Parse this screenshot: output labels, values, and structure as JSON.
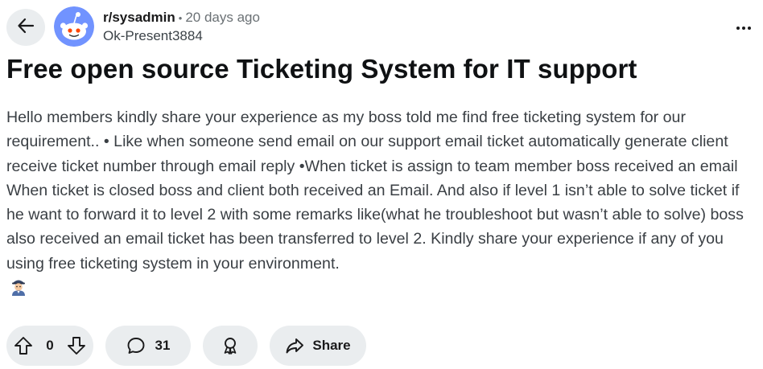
{
  "header": {
    "subreddit": "r/sysadmin",
    "separator": "•",
    "time_ago": "20 days ago",
    "username": "Ok-Present3884",
    "icons": {
      "back": "arrow-left-icon",
      "more": "more-horizontal-icon",
      "avatar": "reddit-snoo-avatar"
    }
  },
  "post": {
    "title": "Free open source Ticketing System for IT support",
    "body": "Hello members kindly share your experience as my boss told me find free ticketing system for our requirement.. • Like when someone send email on our support email ticket automatically generate client receive ticket number through email reply •When ticket is assign to team member boss received an email When ticket is closed boss and client both received an Email. And also if level 1 isn’t able to solve ticket if he want to forward it to level 2 with some remarks like(what he troubleshoot but wasn’t able to solve) boss also received an email ticket has been transferred to level 2. Kindly share your experience if any of you using free ticketing system in your environment.",
    "emoji_icon": "detective-emoji-icon"
  },
  "actions": {
    "vote_count": "0",
    "comment_count": "31",
    "share_label": "Share",
    "icons": {
      "upvote": "upvote-arrow-icon",
      "downvote": "downvote-arrow-icon",
      "comment": "comment-bubble-icon",
      "award": "award-icon",
      "share": "share-arrow-icon"
    }
  },
  "colors": {
    "pill_background": "#eaedef",
    "title": "#0f1113",
    "body_text": "#3a3f44",
    "meta_gray": "#6b7175",
    "avatar_blue": "#7193ff"
  }
}
